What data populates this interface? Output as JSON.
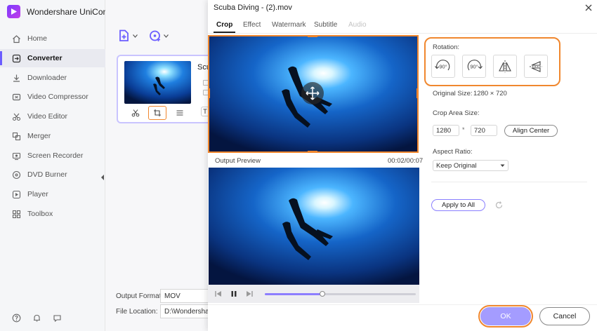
{
  "app": {
    "title": "Wondershare UniConverter"
  },
  "sidebar": {
    "items": [
      {
        "label": "Home",
        "icon": "home-icon"
      },
      {
        "label": "Converter",
        "icon": "converter-icon",
        "active": true
      },
      {
        "label": "Downloader",
        "icon": "downloader-icon"
      },
      {
        "label": "Video Compressor",
        "icon": "compress-icon"
      },
      {
        "label": "Video Editor",
        "icon": "scissors-icon"
      },
      {
        "label": "Merger",
        "icon": "merge-icon"
      },
      {
        "label": "Screen Recorder",
        "icon": "record-icon"
      },
      {
        "label": "DVD Burner",
        "icon": "disc-icon"
      },
      {
        "label": "Player",
        "icon": "play-icon"
      },
      {
        "label": "Toolbox",
        "icon": "grid-icon"
      }
    ],
    "bottom_icons": [
      "help-icon",
      "bell-icon",
      "feedback-icon"
    ]
  },
  "main": {
    "file": {
      "name": "Scu"
    },
    "output_format": {
      "label": "Output Format:",
      "value": "MOV"
    },
    "file_location": {
      "label": "File Location:",
      "value": "D:\\Wondershare"
    }
  },
  "dialog": {
    "title": "Scuba Diving - (2).mov",
    "tabs": [
      {
        "label": "Crop",
        "active": true
      },
      {
        "label": "Effect"
      },
      {
        "label": "Watermark"
      },
      {
        "label": "Subtitle"
      },
      {
        "label": "Audio",
        "disabled": true
      }
    ],
    "preview": {
      "label": "Output Preview",
      "time": "00:02/00:07",
      "progress": 0.38
    },
    "rotation": {
      "label": "Rotation:",
      "buttons": [
        "90°",
        "90°"
      ]
    },
    "original_size": {
      "label": "Original Size:",
      "value": "1280 × 720"
    },
    "crop_area": {
      "label": "Crop Area Size:",
      "width": "1280",
      "times": "*",
      "height": "720",
      "align_label": "Align Center"
    },
    "aspect_ratio": {
      "label": "Aspect Ratio:",
      "value": "Keep Original"
    },
    "apply_all": "Apply to All",
    "ok": "OK",
    "cancel": "Cancel"
  },
  "colors": {
    "accent": "#8d7eff",
    "highlight": "#f0872e"
  }
}
